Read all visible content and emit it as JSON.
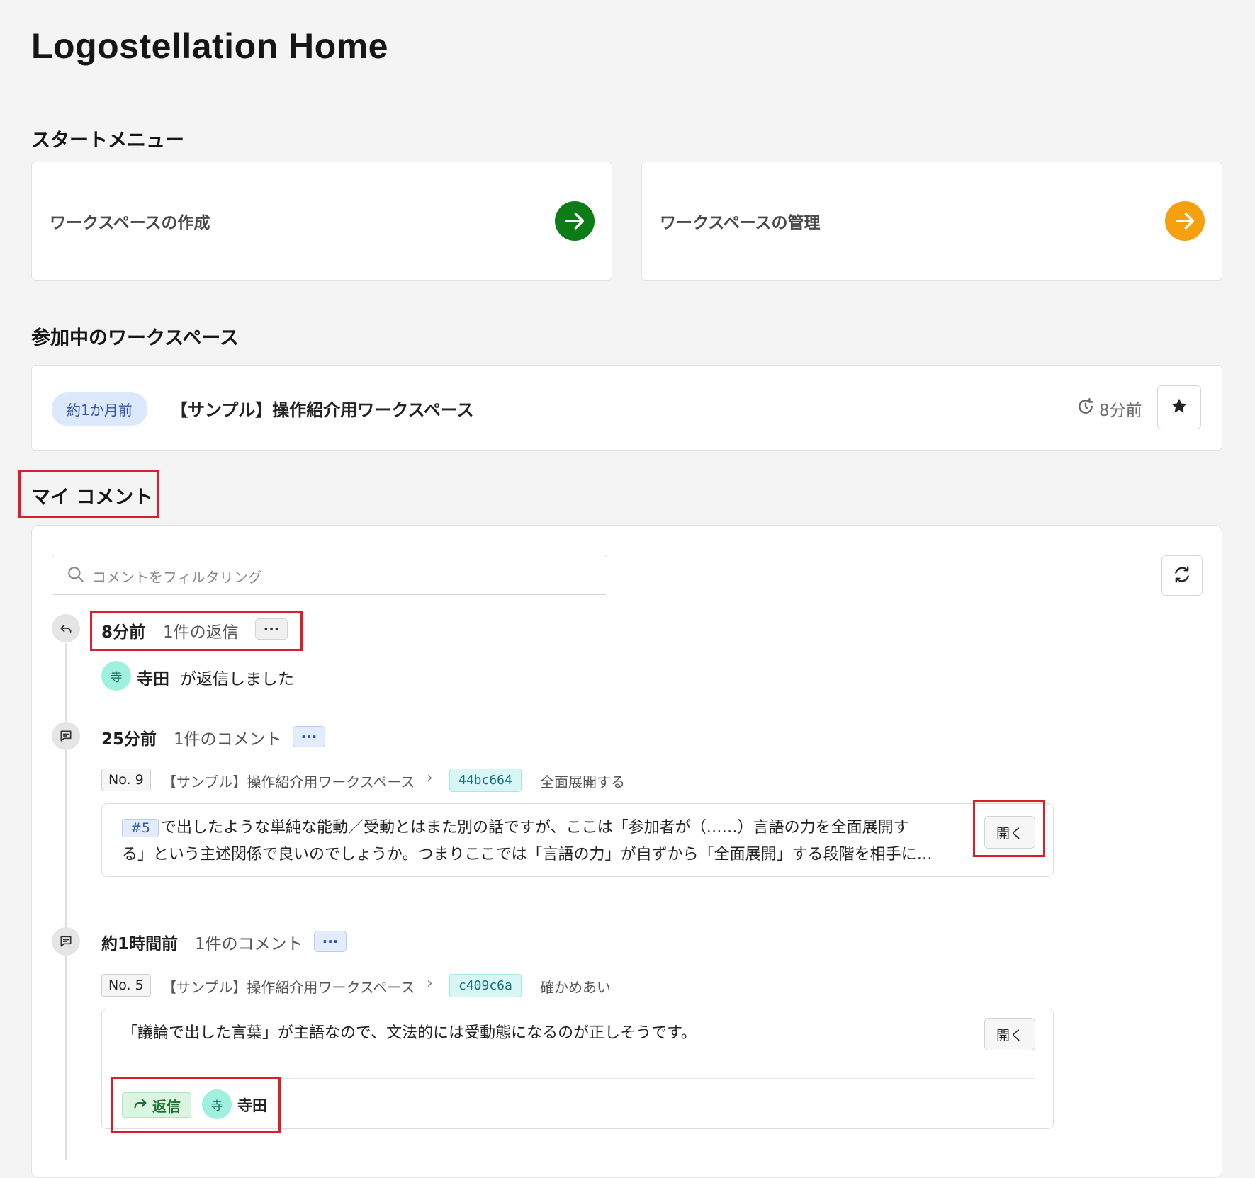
{
  "page": {
    "title": "Logostellation Home"
  },
  "start_menu": {
    "title": "スタートメニュー",
    "items": [
      {
        "label": "ワークスペースの作成",
        "icon": "arrow-right-icon",
        "color": "#0c7d16"
      },
      {
        "label": "ワークスペースの管理",
        "icon": "arrow-right-icon",
        "color": "#f5a00f"
      }
    ]
  },
  "workspaces": {
    "title": "参加中のワークスペース",
    "items": [
      {
        "age_badge": "約1か月前",
        "name": "【サンプル】操作紹介用ワークスペース",
        "updated": "8分前"
      }
    ]
  },
  "my_comments": {
    "title": "マイ コメント",
    "filter_placeholder": "コメントをフィルタリング",
    "entries": [
      {
        "time": "8分前",
        "summary": "1件の返信",
        "dots": "···",
        "avatar_char": "寺",
        "user": "寺田",
        "action": "が返信しました"
      },
      {
        "time": "25分前",
        "summary": "1件のコメント",
        "dots": "···",
        "no": "No. 9",
        "workspace": "【サンプル】操作紹介用ワークスペース",
        "sep": "›",
        "hash": "44bc664",
        "target": "全面展開する",
        "ref": "#5",
        "text_line1": "で出したような単純な能動／受動とはまた別の話ですが、ここは「参加者が（……）言語の力を全面展開す",
        "text_line2": "る」という主述関係で良いのでしょうか。つまりここでは「言語の力」が自ずから「全面展開」する段階を相手に…",
        "open_label": "開く"
      },
      {
        "time": "約1時間前",
        "summary": "1件のコメント",
        "dots": "···",
        "no": "No. 5",
        "workspace": "【サンプル】操作紹介用ワークスペース",
        "sep": "›",
        "hash": "c409c6a",
        "target": "確かめあい",
        "text": "「議論で出した言葉」が主語なので、文法的には受動態になるのが正しそうです。",
        "open_label": "開く",
        "reply_label": "返信",
        "avatar_char": "寺",
        "user": "寺田"
      }
    ]
  }
}
